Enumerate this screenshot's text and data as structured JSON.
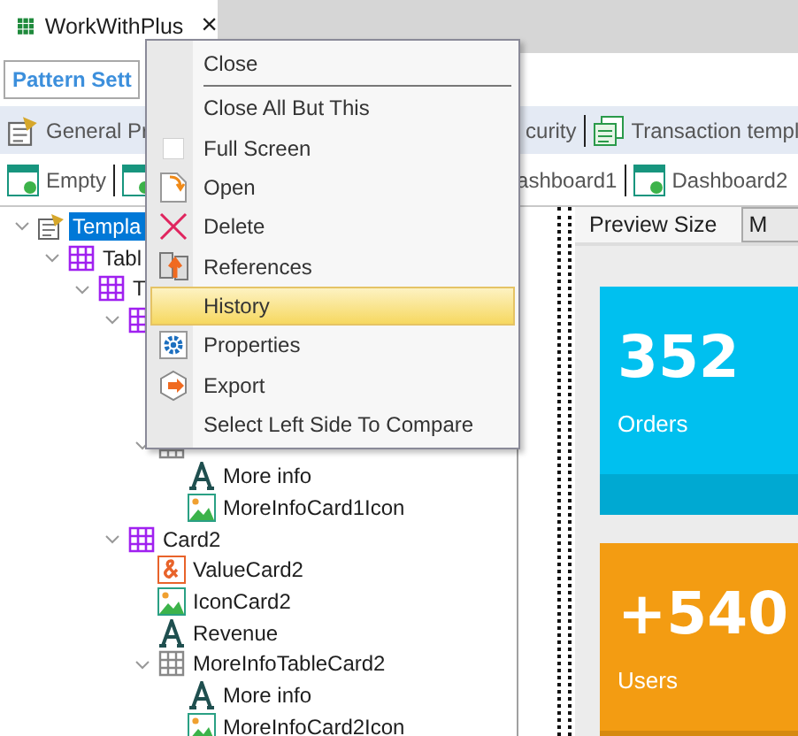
{
  "document_tab": {
    "title": "WorkWithPlus",
    "close": "×"
  },
  "pattern_tab": {
    "label": "Pattern Sett",
    "selected": true
  },
  "toolbar": [
    {
      "label": "General Pr",
      "kind": "with-icon"
    },
    {
      "label": "curity",
      "kind": "text-only"
    },
    {
      "label": "Transaction templ",
      "kind": "with-icon"
    }
  ],
  "templates": [
    {
      "label": "Empty",
      "kind": "with-icon"
    },
    {
      "kind": "icon-only"
    },
    {
      "label": "ashboard1",
      "kind": "text-only"
    },
    {
      "label": "Dashboard2",
      "kind": "with-icon"
    }
  ],
  "tree": [
    {
      "label": "Templa",
      "kind": "template",
      "selected": true,
      "expanded": true,
      "children": [
        {
          "label": "Tabl",
          "kind": "grid",
          "selected": false,
          "expanded": true,
          "children": [
            {
              "label": "T",
              "kind": "grid",
              "selected": false,
              "expanded": true,
              "children": [
                {
                  "kind": "grid",
                  "expanded": true,
                  "children": [
                    {
                      "kind": "covered"
                    },
                    {
                      "kind": "covered"
                    },
                    {
                      "kind": "covered"
                    },
                    {
                      "kind": "grid-plain",
                      "expanded": true,
                      "children": [
                        {
                          "label": "More info",
                          "kind": "text",
                          "selected": false
                        },
                        {
                          "label": "MoreInfoCard1Icon",
                          "kind": "image",
                          "selected": false
                        }
                      ]
                    }
                  ]
                },
                {
                  "label": "Card2",
                  "kind": "grid",
                  "selected": false,
                  "expanded": true,
                  "children": [
                    {
                      "label": "ValueCard2",
                      "kind": "variable",
                      "selected": false
                    },
                    {
                      "label": "IconCard2",
                      "kind": "image",
                      "selected": false
                    },
                    {
                      "label": "Revenue",
                      "kind": "text",
                      "selected": false
                    },
                    {
                      "label": "MoreInfoTableCard2",
                      "kind": "grid-plain",
                      "selected": false,
                      "expanded": true,
                      "children": [
                        {
                          "label": "More info",
                          "kind": "text",
                          "selected": false
                        },
                        {
                          "label": "MoreInfoCard2Icon",
                          "kind": "image",
                          "selected": false
                        }
                      ]
                    }
                  ]
                }
              ]
            }
          ]
        }
      ]
    }
  ],
  "preview": {
    "label": "Preview Size",
    "select": "M",
    "cards": [
      {
        "value": "352",
        "caption": "Orders",
        "color": "#00c0ef"
      },
      {
        "value": "+540",
        "caption": "Users",
        "color": "#f39c12"
      }
    ]
  },
  "context_menu": [
    {
      "label": "Close",
      "kind": "plain",
      "selected": false,
      "separator_after": true
    },
    {
      "label": "Close All But This",
      "kind": "plain",
      "selected": false,
      "separator_after": false
    },
    {
      "label": "Full Screen",
      "kind": "square",
      "selected": false,
      "separator_after": false
    },
    {
      "label": "Open",
      "kind": "open",
      "selected": false,
      "separator_after": false
    },
    {
      "label": "Delete",
      "kind": "delete",
      "selected": false,
      "separator_after": false
    },
    {
      "label": "References",
      "kind": "references",
      "selected": false,
      "separator_after": false
    },
    {
      "label": "History",
      "kind": "plain",
      "selected": true,
      "separator_after": false
    },
    {
      "label": "Properties",
      "kind": "gear",
      "selected": false,
      "separator_after": false
    },
    {
      "label": "Export",
      "kind": "export",
      "selected": false,
      "separator_after": false
    },
    {
      "label": "Select Left Side To Compare",
      "kind": "plain",
      "selected": false,
      "separator_after": false
    }
  ]
}
